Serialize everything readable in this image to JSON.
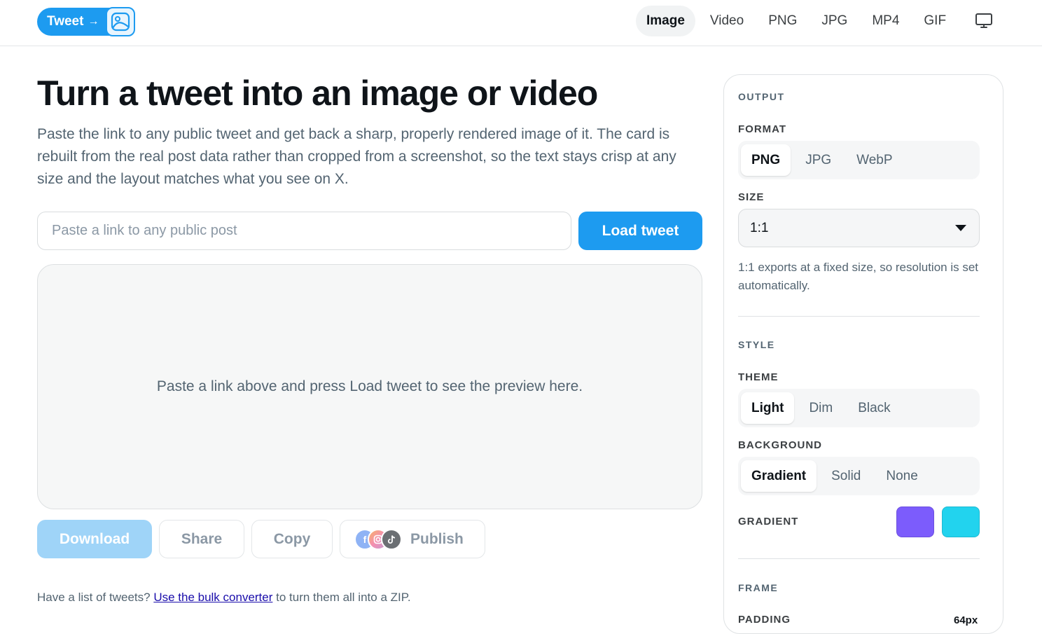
{
  "header": {
    "logo_text": "Tweet",
    "logo_arrow": "→",
    "nav": [
      {
        "label": "Image",
        "active": true
      },
      {
        "label": "Video",
        "active": false
      },
      {
        "label": "PNG",
        "active": false
      },
      {
        "label": "JPG",
        "active": false
      },
      {
        "label": "MP4",
        "active": false
      },
      {
        "label": "GIF",
        "active": false
      }
    ],
    "display_icon": "monitor-icon"
  },
  "main": {
    "title": "Turn a tweet into an image or video",
    "description": "Paste the link to any public tweet and get back a sharp, properly rendered image of it. The card is rebuilt from the real post data rather than cropped from a screenshot, so the text stays crisp at any size and the layout matches what you see on X.",
    "url_input": {
      "value": "",
      "placeholder": "Paste a link to any public post"
    },
    "load_button": "Load tweet",
    "preview_placeholder": "Paste a link above and press Load tweet to see the preview here.",
    "actions": {
      "download": "Download",
      "share": "Share",
      "copy": "Copy",
      "publish": "Publish",
      "publish_icons": [
        "facebook-icon",
        "instagram-icon",
        "tiktok-icon"
      ]
    },
    "footnote": {
      "before": "Have a list of tweets?",
      "link": "Use the bulk converter",
      "after": "to turn them all into a ZIP."
    }
  },
  "panel": {
    "output": {
      "section": "OUTPUT",
      "format_label": "FORMAT",
      "format_options": [
        "PNG",
        "JPG",
        "WebP"
      ],
      "format_selected": "PNG",
      "size_label": "SIZE",
      "size_value": "1:1",
      "size_hint": "1:1 exports at a fixed size, so resolution is set automatically."
    },
    "style": {
      "section": "STYLE",
      "theme_label": "THEME",
      "theme_options": [
        "Light",
        "Dim",
        "Black"
      ],
      "theme_selected": "Light",
      "background_label": "BACKGROUND",
      "background_options": [
        "Gradient",
        "Solid",
        "None"
      ],
      "background_selected": "Gradient",
      "gradient_label": "GRADIENT",
      "gradient_colors": [
        "#7c5cfc",
        "#22d3ee"
      ]
    },
    "frame": {
      "section": "FRAME",
      "padding_label": "PADDING",
      "padding_value": "64px"
    }
  },
  "colors": {
    "accent": "#1d9bf0",
    "accent_disabled": "#9fd4f8"
  }
}
